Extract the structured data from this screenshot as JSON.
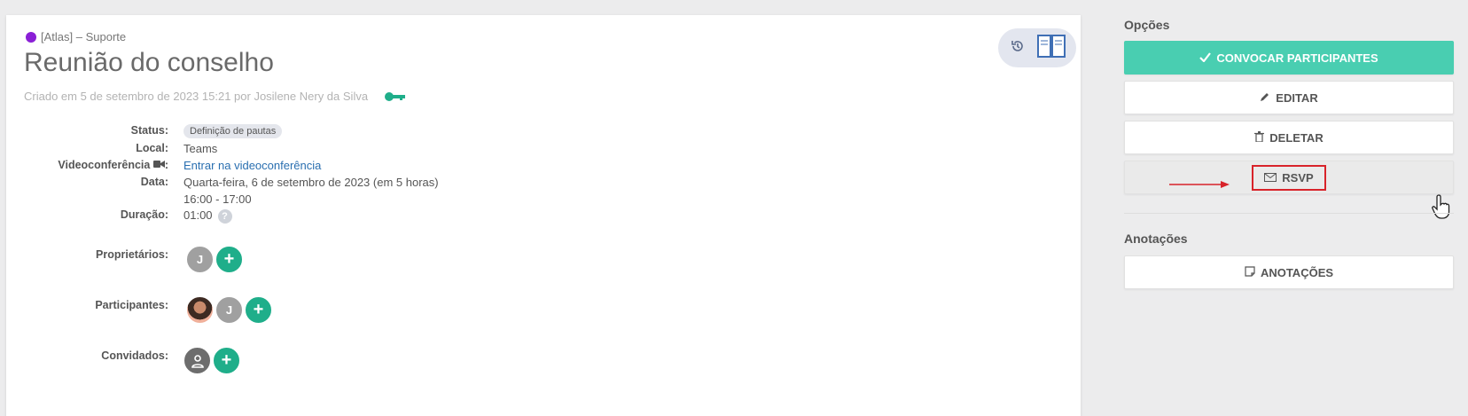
{
  "meeting": {
    "group": "[Atlas] – Suporte",
    "title": "Reunião do conselho",
    "created": "Criado em 5 de setembro de 2023 15:21 por Josilene Nery da Silva"
  },
  "details": {
    "status_label": "Status:",
    "status_value": "Definição de pautas",
    "local_label": "Local:",
    "local_value": "Teams",
    "video_label": "Videoconferência",
    "video_link": "Entrar na videoconferência",
    "date_label": "Data:",
    "date_value": "Quarta-feira, 6 de setembro de 2023  (em 5 horas)",
    "time_value": "16:00 - 17:00",
    "duration_label": "Duração:",
    "duration_value": "01:00",
    "help_glyph": "?"
  },
  "people": {
    "owners_label": "Proprietários:",
    "participants_label": "Participantes:",
    "guests_label": "Convidados:",
    "initial_j": "J",
    "add_glyph": "+"
  },
  "sidebar": {
    "options_label": "Opções",
    "convocar": "CONVOCAR PARTICIPANTES",
    "editar": "EDITAR",
    "deletar": "DELETAR",
    "rsvp": "RSVP",
    "annotations_label": "Anotações",
    "anotacoes": "ANOTAÇÕES"
  },
  "colors": {
    "accent": "#49ceb1",
    "add_button": "#1fae8a",
    "group_dot": "#8a1fd6",
    "highlight": "#d8232a"
  },
  "icons": [
    "history-icon",
    "book-icon",
    "key-icon",
    "video-icon",
    "check-icon",
    "pencil-icon",
    "trash-icon",
    "envelope-icon",
    "note-icon",
    "hand-cursor-icon",
    "user-icon"
  ]
}
